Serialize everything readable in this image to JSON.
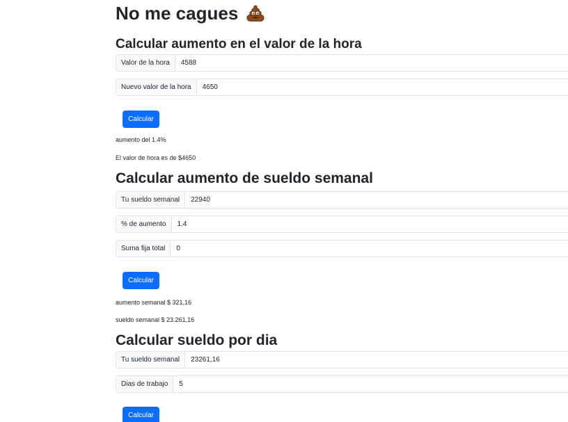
{
  "page_title": "No me cagues",
  "title_icon": "pile-of-poo-icon",
  "accent_color": "#0d6efd",
  "section_hora": {
    "title": "Calcular aumento en el valor de la hora",
    "field_valor_label": "Valor de la hora",
    "field_valor_value": "4588",
    "field_nuevo_label": "Nuevo valor de la hora",
    "field_nuevo_value": "4650",
    "button_label": "Calcular",
    "result_aumento": "aumento del 1.4%",
    "result_valor": "El valor de hora es de $4650"
  },
  "section_semanal": {
    "title": "Calcular aumento de sueldo semanal",
    "field_sueldo_label": "Tu sueldo semanal",
    "field_sueldo_value": "22940",
    "field_aumento_label": "% de aumento",
    "field_aumento_value": "1.4",
    "field_suma_label": "Suma fija total",
    "field_suma_value": "0",
    "button_label": "Calcular",
    "result_aumento": "aumento semanal $ 321,16",
    "result_sueldo": "sueldo semanal $ 23.261,16"
  },
  "section_dia": {
    "title": "Calcular sueldo por dia",
    "field_sueldo_label": "Tu sueldo semanal",
    "field_sueldo_value": "23261,16",
    "field_dias_label": "Dias de trabajo",
    "field_dias_value": "5",
    "button_label": "Calcular"
  }
}
